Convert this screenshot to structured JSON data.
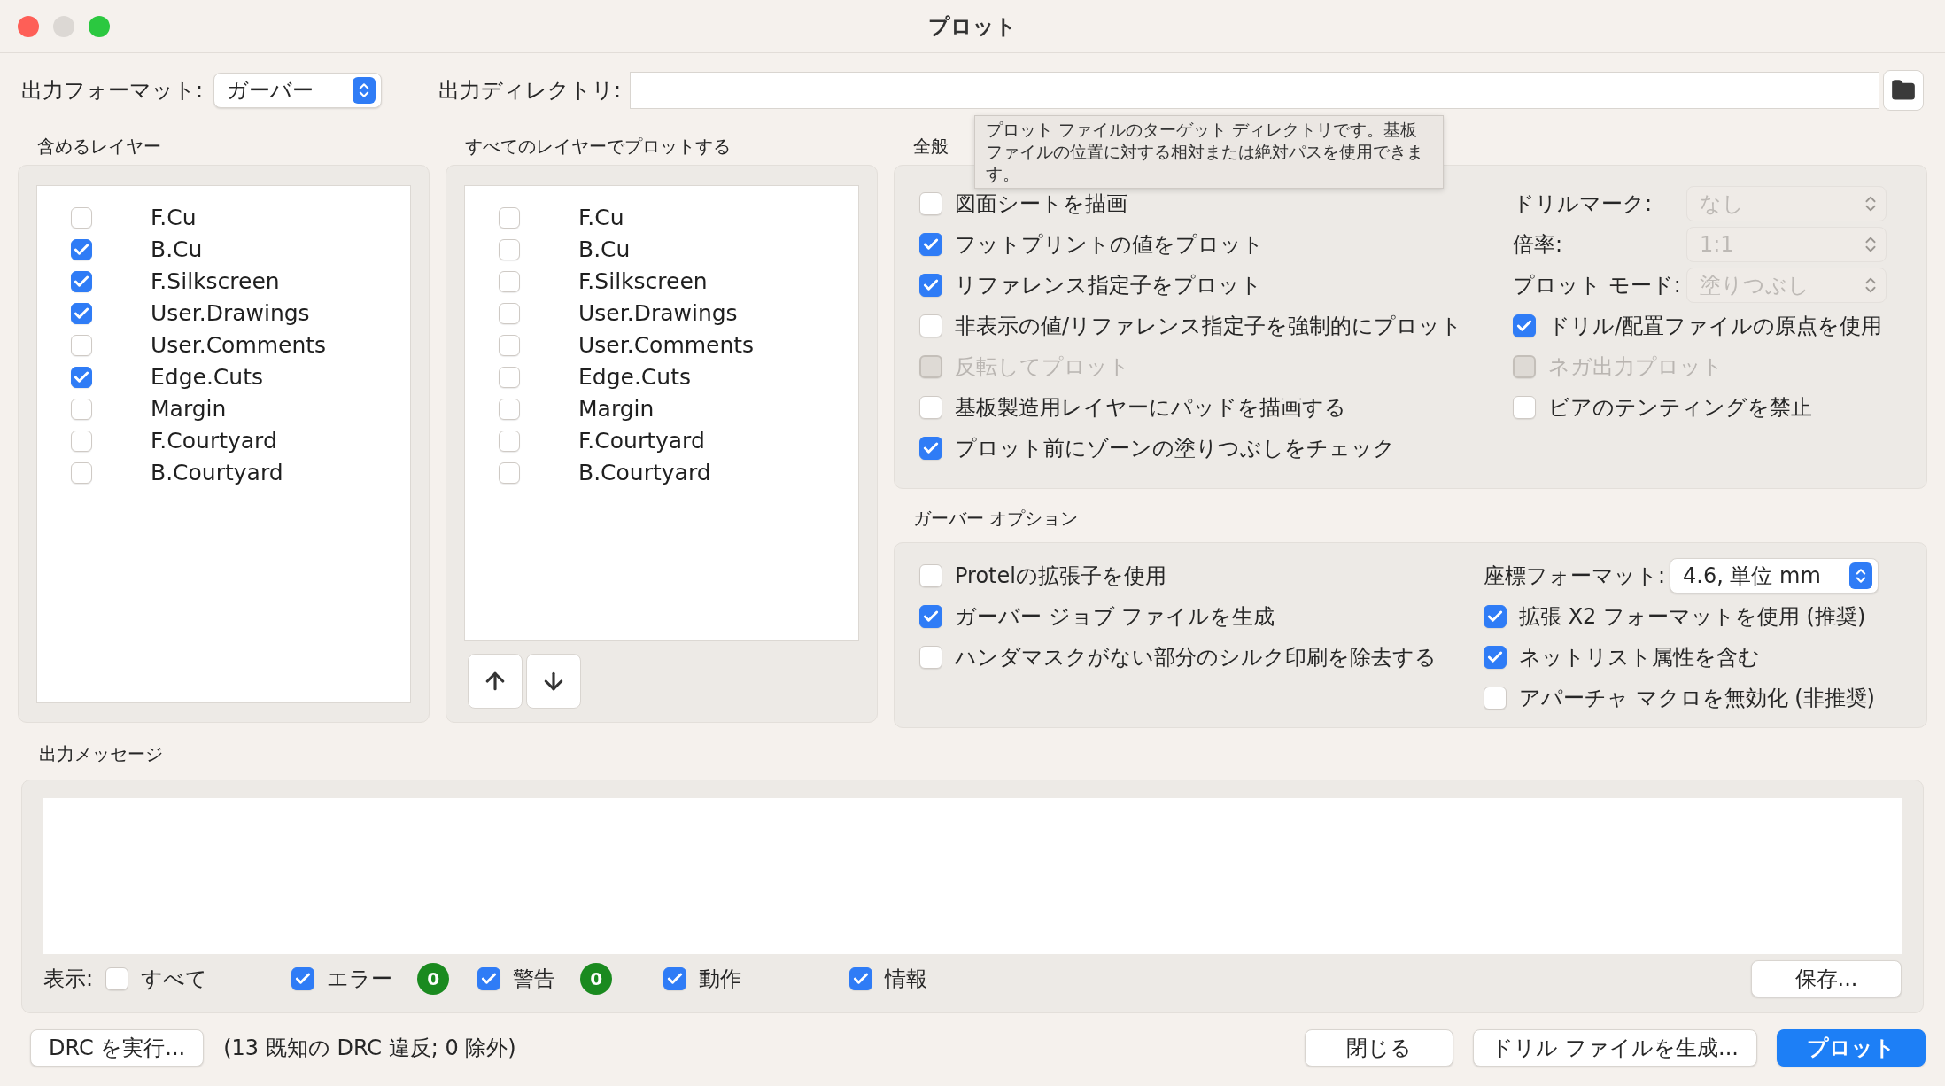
{
  "window": {
    "title": "プロット"
  },
  "output_format": {
    "label": "出力フォーマット:",
    "value": "ガーバー"
  },
  "output_directory": {
    "label": "出力ディレクトリ:"
  },
  "tooltip": "プロット ファイルのターゲット ディレクトリです。基板ファイルの位置に対する相対または絶対パスを使用できます。",
  "include_layers": {
    "title": "含めるレイヤー",
    "items": [
      {
        "label": "F.Cu",
        "checked": false
      },
      {
        "label": "B.Cu",
        "checked": true
      },
      {
        "label": "F.Silkscreen",
        "checked": true
      },
      {
        "label": "User.Drawings",
        "checked": true
      },
      {
        "label": "User.Comments",
        "checked": false
      },
      {
        "label": "Edge.Cuts",
        "checked": true
      },
      {
        "label": "Margin",
        "checked": false
      },
      {
        "label": "F.Courtyard",
        "checked": false
      },
      {
        "label": "B.Courtyard",
        "checked": false
      }
    ]
  },
  "plot_all_layers": {
    "title": "すべてのレイヤーでプロットする",
    "items": [
      {
        "label": "F.Cu",
        "checked": false
      },
      {
        "label": "B.Cu",
        "checked": false
      },
      {
        "label": "F.Silkscreen",
        "checked": false
      },
      {
        "label": "User.Drawings",
        "checked": false
      },
      {
        "label": "User.Comments",
        "checked": false
      },
      {
        "label": "Edge.Cuts",
        "checked": false
      },
      {
        "label": "Margin",
        "checked": false
      },
      {
        "label": "F.Courtyard",
        "checked": false
      },
      {
        "label": "B.Courtyard",
        "checked": false
      }
    ]
  },
  "general_options": {
    "title": "全般",
    "left": [
      {
        "label": "図面シートを描画",
        "checked": false,
        "disabled": false
      },
      {
        "label": "フットプリントの値をプロット",
        "checked": true,
        "disabled": false
      },
      {
        "label": "リファレンス指定子をプロット",
        "checked": true,
        "disabled": false
      },
      {
        "label": "非表示の値/リファレンス指定子を強制的にプロット",
        "checked": false,
        "disabled": false
      },
      {
        "label": "反転してプロット",
        "checked": false,
        "disabled": true
      },
      {
        "label": "基板製造用レイヤーにパッドを描画する",
        "checked": false,
        "disabled": false
      },
      {
        "label": "プロット前にゾーンの塗りつぶしをチェック",
        "checked": true,
        "disabled": false
      }
    ],
    "selects": [
      {
        "label": "ドリルマーク:",
        "value": "なし",
        "disabled": true
      },
      {
        "label": "倍率:",
        "value": "1:1",
        "disabled": true
      },
      {
        "label": "プロット モード:",
        "value": "塗りつぶし",
        "disabled": true
      }
    ],
    "right": [
      {
        "label": "ドリル/配置ファイルの原点を使用",
        "checked": true,
        "disabled": false
      },
      {
        "label": "ネガ出力プロット",
        "checked": false,
        "disabled": true
      },
      {
        "label": "ビアのテンティングを禁止",
        "checked": false,
        "disabled": false
      }
    ]
  },
  "gerber_options": {
    "title": "ガーバー オプション",
    "left": [
      {
        "label": "Protelの拡張子を使用",
        "checked": false,
        "disabled": false
      },
      {
        "label": "ガーバー ジョブ ファイルを生成",
        "checked": true,
        "disabled": false
      },
      {
        "label": "ハンダマスクがない部分のシルク印刷を除去する",
        "checked": false,
        "disabled": false
      }
    ],
    "coord_format": {
      "label": "座標フォーマット:",
      "value": "4.6, 単位 mm",
      "disabled": false
    },
    "right": [
      {
        "label": "拡張 X2 フォーマットを使用 (推奨)",
        "checked": true,
        "disabled": false
      },
      {
        "label": "ネットリスト属性を含む",
        "checked": true,
        "disabled": false
      },
      {
        "label": "アパーチャ マクロを無効化 (非推奨)",
        "checked": false,
        "disabled": false
      }
    ]
  },
  "messages": {
    "title": "出力メッセージ",
    "show_label": "表示:",
    "filters": [
      {
        "label": "すべて",
        "checked": false
      },
      {
        "label": "エラー",
        "checked": true,
        "count": "0"
      },
      {
        "label": "警告",
        "checked": true,
        "count": "0"
      },
      {
        "label": "動作",
        "checked": true
      },
      {
        "label": "情報",
        "checked": true
      }
    ],
    "save_button": "保存..."
  },
  "footer": {
    "drc_button": "DRC を実行...",
    "drc_status": "(13 既知の DRC 違反; 0 除外)",
    "buttons": [
      {
        "label": "閉じる",
        "kind": "default"
      },
      {
        "label": "ドリル ファイルを生成...",
        "kind": "default"
      },
      {
        "label": "プロット",
        "kind": "primary"
      }
    ]
  }
}
